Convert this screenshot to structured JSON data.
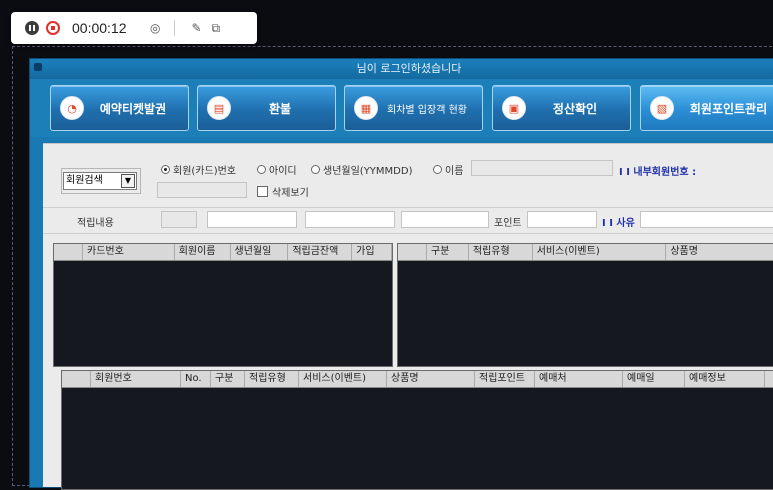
{
  "recorder": {
    "timer": "00:00:12"
  },
  "window": {
    "title": "님이 로그인하셨습니다"
  },
  "toolbar": {
    "buttons": [
      {
        "label": "예약티켓발권"
      },
      {
        "label": "환불"
      },
      {
        "label": "회차별 입장객 현황"
      },
      {
        "label": "정산확인"
      },
      {
        "label": "회원포인트관리"
      }
    ]
  },
  "search": {
    "combo_value": "회원검색",
    "radio_options": [
      "회원(카드)번호",
      "아이디",
      "생년월일(YYMMDD)",
      "이름"
    ],
    "selected_radio": "회원(카드)번호",
    "internal_member_label": "I I 내부회원번호 :",
    "delete_view_label": "삭제보기",
    "accumulate_label": "적립내용",
    "point_label": "포인트",
    "reason_label": "I I 사유"
  },
  "grid_members": {
    "columns": [
      "카드번호",
      "회원이름",
      "생년월일",
      "적립금잔액",
      "가입"
    ]
  },
  "grid_accum": {
    "columns": [
      "구분",
      "적립유형",
      "서비스(이벤트)",
      "상품명"
    ]
  },
  "grid_history": {
    "columns": [
      "회원번호",
      "No.",
      "구분",
      "적립유형",
      "서비스(이벤트)",
      "상품명",
      "적립포인트",
      "예매처",
      "예매일",
      "예매정보"
    ]
  }
}
